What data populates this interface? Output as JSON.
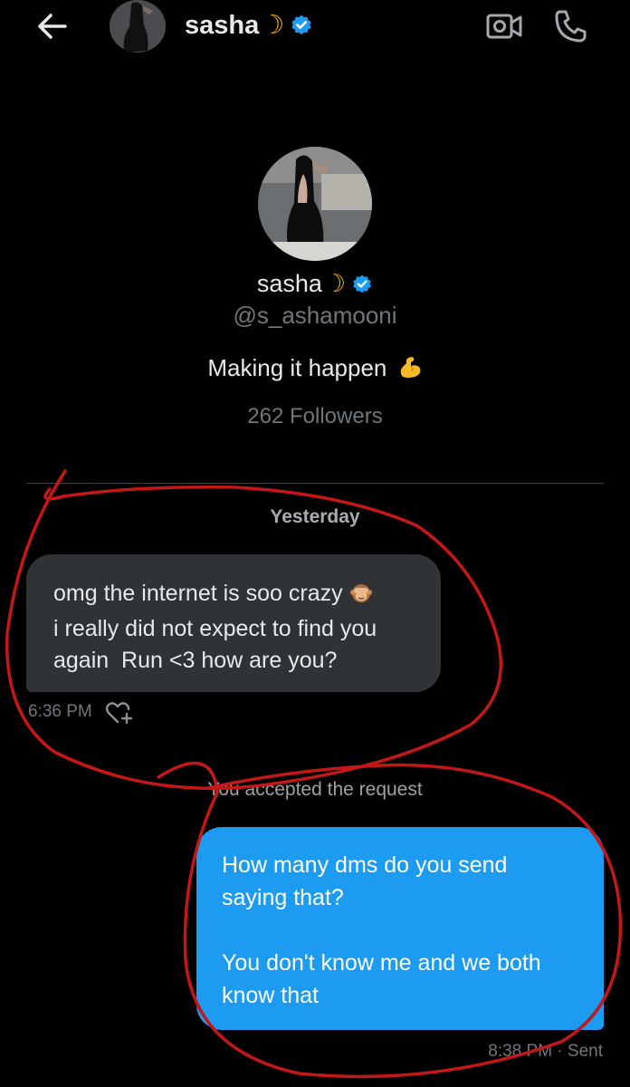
{
  "header": {
    "name": "sasha",
    "moon": "☽"
  },
  "profile": {
    "name": "sasha",
    "moon": "☽",
    "handle": "@s_ashamooni",
    "bio": "Making it happen",
    "bio_emoji": "flexed-biceps-icon",
    "followers": "262 Followers"
  },
  "chat": {
    "date_separator": "Yesterday",
    "incoming": {
      "line1": "omg the internet is soo crazy",
      "line1_emoji": "see-no-evil-monkey-icon",
      "line2": "i really did not expect to find you",
      "line3": "again  Run <3 how are you?",
      "time": "6:36 PM"
    },
    "system_message": "You accepted the request",
    "outgoing": {
      "para1_line1": "How many dms do you send",
      "para1_line2": "saying that?",
      "para2_line1": "You don't know me and we both",
      "para2_line2": "know that",
      "status": "8:38 PM · Sent"
    }
  },
  "colors": {
    "background": "#000000",
    "incoming_bubble": "#2f3336",
    "outgoing_bubble": "#1d9bf0",
    "verified": "#1d9bf0",
    "muted_text": "#71767b",
    "annotation_red": "#c41818"
  }
}
